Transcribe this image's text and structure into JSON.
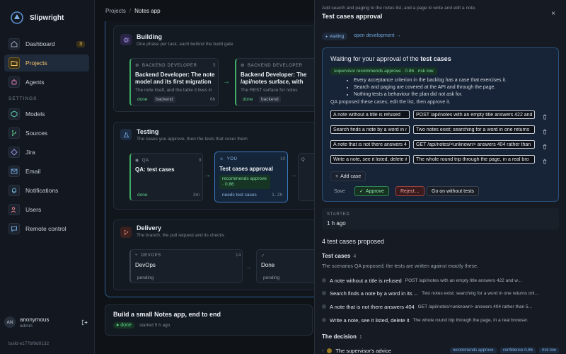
{
  "app": {
    "name": "Slipwright"
  },
  "sidebar": {
    "items": [
      {
        "label": "Dashboard",
        "badge": "3"
      },
      {
        "label": "Projects"
      },
      {
        "label": "Agents"
      }
    ],
    "settings_label": "SETTINGS",
    "settings_items": [
      {
        "label": "Models"
      },
      {
        "label": "Sources"
      },
      {
        "label": "Jira"
      },
      {
        "label": "Email"
      },
      {
        "label": "Notifications"
      },
      {
        "label": "Users"
      },
      {
        "label": "Remote control"
      }
    ],
    "user": {
      "initials": "AN",
      "name": "anonymous",
      "role": "admin"
    },
    "build": "build e177bf9d0132"
  },
  "breadcrumb": {
    "root": "Projects",
    "sep": "/",
    "current": "Notes app"
  },
  "stages": {
    "building": {
      "title": "Building",
      "subtitle": "One phase per task, each behind the build gate",
      "cards": [
        {
          "role": "BACKEND DEVELOPER",
          "num": "5",
          "title": "Backend Developer: The note model and its first migration",
          "sub": "The note itself, and the table it lives in",
          "status": "done",
          "tag": "backend",
          "time": "6h"
        },
        {
          "role": "BACKEND DEVELOPER",
          "num": "",
          "title": "Backend Developer: The /api/notes surface, with search",
          "sub": "The REST surface for notes",
          "status": "done",
          "tag": "backend",
          "time": ""
        }
      ]
    },
    "testing": {
      "title": "Testing",
      "subtitle": "The cases you approve, then the tests that cover them",
      "cards": [
        {
          "role": "QA",
          "num": "9",
          "title": "QA: test cases",
          "status": "done",
          "time": "3m"
        },
        {
          "role": "YOU",
          "num": "10",
          "title": "Test cases approval",
          "rec": "recommends approve · 0.86",
          "status": "needs test cases",
          "time": "1.2h"
        }
      ],
      "ghost_role": "Q"
    },
    "delivery": {
      "title": "Delivery",
      "subtitle": "The branch, the pull request and its checks",
      "cards": [
        {
          "role": "DEVOPS",
          "num": "14",
          "title": "DevOps",
          "status": "pending"
        },
        {
          "role": "",
          "num": "",
          "title": "Done",
          "status": "pending"
        }
      ]
    }
  },
  "project": {
    "title": "Build a small Notes app, end to end",
    "status": "done",
    "started": "started 5 h ago"
  },
  "panel": {
    "subtitle": "Add search and paging to the notes list, and a page to write and edit a note.",
    "title": "Test cases approval",
    "close": "×",
    "waiting": "waiting",
    "dev_link": "open development →",
    "approval": {
      "title_prefix": "Waiting for your approval of the",
      "title_bold": "test cases",
      "rec": "supervisor recommends approve · 0.86 · risk low",
      "bullets": [
        "Every acceptance criterion in the backlog has a case that exercises it.",
        "Search and paging are covered at the API and through the page.",
        "Nothing tests a behaviour the plan did not ask for."
      ],
      "proposed": "QA proposed these cases; edit the list, then approve it.",
      "cases": [
        {
          "name": "A note without a title is refused",
          "desc": "POST /api/notes with an empty title answers 422 and"
        },
        {
          "name": "Search finds a note by a word in its",
          "desc": "Two notes exist; searching for a word in one returns"
        },
        {
          "name": "A note that is not there answers 404",
          "desc": "GET /api/notes/<unknown> answers 404 rather than"
        },
        {
          "name": "Write a note, see it listed, delete it",
          "desc": "The whole round trip through the page, in a real bro"
        }
      ],
      "add_case": "Add case",
      "save": "Save",
      "approve": "Approve",
      "reject": "Reject…",
      "go_without": "Go on without tests"
    },
    "started_label": "STARTED",
    "started_value": "1 h ago",
    "tcp": "4 test cases proposed",
    "test_cases": {
      "title": "Test cases",
      "count": "4",
      "subtitle": "The scenarios QA proposed; the tests are written against exactly these."
    },
    "list": [
      {
        "name": "A note without a title is refused",
        "desc": "POST /api/notes with an empty title answers 422 and w..."
      },
      {
        "name": "Search finds a note by a word in its ...",
        "desc": "Two notes exist; searching for a word in one returns onl..."
      },
      {
        "name": "A note that is not there answers 404",
        "desc": "GET /api/notes/<unknown> answers 404 rather than 5..."
      },
      {
        "name": "Write a note, see it listed, delete it",
        "desc": "The whole round trip through the page, in a real browser."
      }
    ],
    "decision": {
      "title": "The decision",
      "count": "1",
      "advice": "The supervisor's advice",
      "tags": [
        "recommends approve",
        "confidence 0.86",
        "risk low"
      ]
    }
  },
  "colors": {
    "accent": "#f5c66b",
    "approve": "#2f8a52",
    "reject": "#a2443f",
    "focus": "#2a4f79"
  }
}
